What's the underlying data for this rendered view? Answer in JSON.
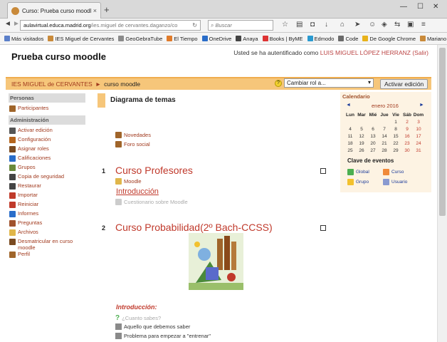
{
  "browser": {
    "tab_title": "Curso: Prueba curso moodle",
    "tab_close": "×",
    "new_tab": "+",
    "url_host": "aulavirtual.educa.madrid.org",
    "url_path": "/ies.miguel de cervantes.daganzo/co",
    "search_placeholder": "Buscar",
    "bookmarks": [
      {
        "label": "Más visitados",
        "color": "#5b7fc9"
      },
      {
        "label": "IES Miguel de Cervantes",
        "color": "#c98a3a"
      },
      {
        "label": "GeoGebraTube",
        "color": "#8a8a8a"
      },
      {
        "label": "El Tiempo",
        "color": "#e07b2a"
      },
      {
        "label": "OneDrive",
        "color": "#2a6dc9"
      },
      {
        "label": "Anaya",
        "color": "#444"
      },
      {
        "label": "Books | ByME",
        "color": "#d33"
      },
      {
        "label": "Edmodo",
        "color": "#2a9ad0"
      },
      {
        "label": "Code",
        "color": "#6a6a6a"
      },
      {
        "label": "De Google Chrome",
        "color": "#e8b21a"
      },
      {
        "label": "Mariano",
        "color": "#c98a3a"
      }
    ]
  },
  "header": {
    "site_title": "Prueba curso moodle",
    "login_prefix": "Usted se ha autentificado como",
    "user_name": "LUIS MIGUEL LÓPEZ HERRANZ",
    "logout": "(Salir)"
  },
  "breadcrumb": {
    "home": "IES MIGUEL de CERVANTES",
    "sep": "►",
    "current": "curso moodle",
    "role_select": "Cambiar rol a...",
    "edit_button": "Activar edición",
    "help": "?"
  },
  "people_block": {
    "title": "Personas",
    "items": [
      {
        "label": "Participantes",
        "color": "#a0652a"
      }
    ]
  },
  "admin_block": {
    "title": "Administración",
    "items": [
      {
        "label": "Activar edición",
        "color": "#555"
      },
      {
        "label": "Configuración",
        "color": "#b5651d"
      },
      {
        "label": "Asignar roles",
        "color": "#7a4a20"
      },
      {
        "label": "Calificaciones",
        "color": "#2a6dc9"
      },
      {
        "label": "Grupos",
        "color": "#6a8a3a"
      },
      {
        "label": "Copia de seguridad",
        "color": "#444"
      },
      {
        "label": "Restaurar",
        "color": "#444"
      },
      {
        "label": "Importar",
        "color": "#c03a2a"
      },
      {
        "label": "Reiniciar",
        "color": "#c03a2a"
      },
      {
        "label": "Informes",
        "color": "#2a6dc9"
      },
      {
        "label": "Preguntas",
        "color": "#a0522d"
      },
      {
        "label": "Archivos",
        "color": "#e0b64a"
      },
      {
        "label": "Desmatricular en curso moodle",
        "color": "#7a4a20"
      },
      {
        "label": "Perfil",
        "color": "#a0652a"
      }
    ]
  },
  "main": {
    "topics_title": "Diagrama de temas",
    "section0_items": [
      {
        "label": "Novedades",
        "color": "#a0652a"
      },
      {
        "label": "Foro social",
        "color": "#a0652a"
      }
    ],
    "section1": {
      "number": "1",
      "title": "Curso Profesores",
      "folder": "Moodle",
      "subtitle": "Introducción",
      "dim_item": "Cuestionario sobre Moodle"
    },
    "section2": {
      "number": "2",
      "title": "Curso Probabilidad(2º Bach-CCSS)",
      "intro": "Introducción:",
      "dim_item": "¿Cuanto sabes?",
      "links": [
        "Aquello que debemos saber",
        "Problema para empezar a \"entrenar\""
      ]
    }
  },
  "calendar": {
    "title": "Calendario",
    "prev": "◄",
    "next": "►",
    "month": "enero 2016",
    "weekdays": [
      "Lun",
      "Mar",
      "Mié",
      "Jue",
      "Vie",
      "Sáb",
      "Dom"
    ],
    "weeks": [
      [
        "",
        "",
        "",
        "",
        "1",
        "2",
        "3"
      ],
      [
        "4",
        "5",
        "6",
        "7",
        "8",
        "9",
        "10"
      ],
      [
        "11",
        "12",
        "13",
        "14",
        "15",
        "16",
        "17"
      ],
      [
        "18",
        "19",
        "20",
        "21",
        "22",
        "23",
        "24"
      ],
      [
        "25",
        "26",
        "27",
        "28",
        "29",
        "30",
        "31"
      ]
    ],
    "legend_title": "Clave de eventos",
    "legend": [
      {
        "label": "Global",
        "color": "#4caf50"
      },
      {
        "label": "Curso",
        "color": "#f08a3a"
      },
      {
        "label": "Grupo",
        "color": "#f2c12e"
      },
      {
        "label": "Usuario",
        "color": "#8a9ad0"
      }
    ]
  }
}
